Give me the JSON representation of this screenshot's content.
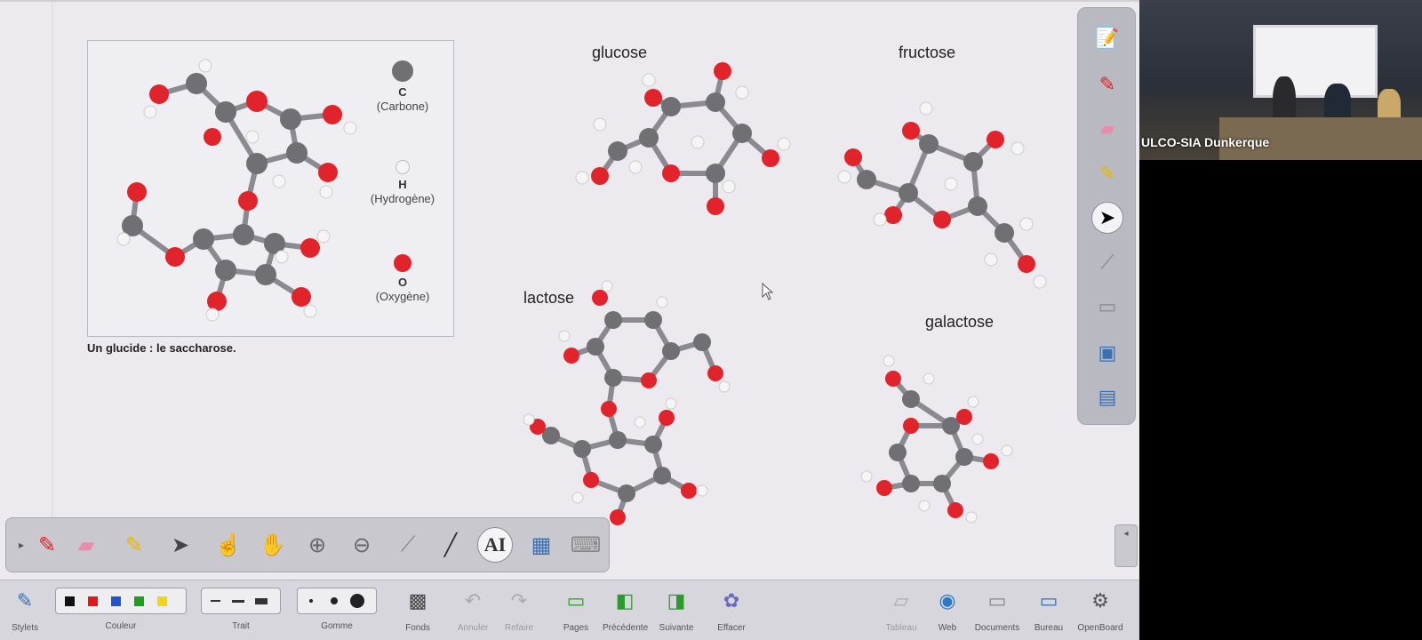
{
  "figure": {
    "caption": "Un glucide : le saccharose.",
    "legend": [
      {
        "symbol": "C",
        "name": "(Carbone)",
        "color": "#666666"
      },
      {
        "symbol": "H",
        "name": "(Hydrogène)",
        "color": "#f4f4f4"
      },
      {
        "symbol": "O",
        "name": "(Oxygène)",
        "color": "#e0202a"
      }
    ]
  },
  "molecules": {
    "glucose": "glucose",
    "fructose": "fructose",
    "lactose": "lactose",
    "galactose": "galactose"
  },
  "colors": {
    "carbon": "#6f6f74",
    "hydrogen": "#f5f5f5",
    "oxygen": "#e1232c",
    "bond": "#8a8a90"
  },
  "side_toolbar": {
    "icons": [
      "page-edit-icon",
      "pen-icon",
      "eraser-icon",
      "highlighter-icon",
      "pointer-icon",
      "laser-icon",
      "ruler-icon",
      "display-icon",
      "desktop-icon"
    ]
  },
  "palette": {
    "icons": [
      "stylus-icon",
      "eraser-icon",
      "highlighter-icon",
      "pointer-icon",
      "hand-pointer-icon",
      "hand-icon",
      "zoom-in-icon",
      "zoom-out-icon",
      "laser-icon",
      "line-icon",
      "text-icon",
      "capture-icon",
      "keyboard-icon"
    ],
    "text_tool": "AI"
  },
  "bottom_toolbar": {
    "stylets": "Stylets",
    "couleur": "Couleur",
    "trait": "Trait",
    "gomme": "Gomme",
    "fonds": "Fonds",
    "annuler": "Annuler",
    "refaire": "Refaire",
    "pages": "Pages",
    "precedente": "Précédente",
    "suivante": "Suivante",
    "effacer": "Effacer",
    "tableau": "Tableau",
    "web": "Web",
    "documents": "Documents",
    "bureau": "Bureau",
    "openboard": "OpenBoard",
    "colors": [
      "#111111",
      "#e3161b",
      "#2255cc",
      "#1aa01a",
      "#f2d515"
    ]
  },
  "webcam": {
    "label": "ULCO-SIA Dunkerque"
  }
}
